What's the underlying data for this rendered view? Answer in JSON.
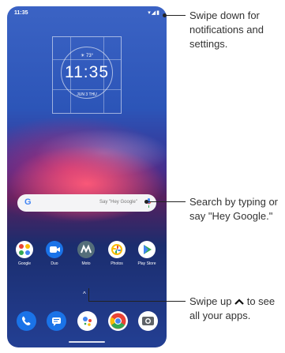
{
  "status_bar": {
    "time": "11:35",
    "icons": "▾◢▮"
  },
  "clock_widget": {
    "weather": "☀ 73°",
    "time": "11:35",
    "date": "JUN 3 THU"
  },
  "search_bar": {
    "logo": "G",
    "hint": "Say \"Hey Google\""
  },
  "apps": [
    {
      "label": "Google"
    },
    {
      "label": "Duo"
    },
    {
      "label": "Moto"
    },
    {
      "label": "Photos"
    },
    {
      "label": "Play Store"
    }
  ],
  "dock": [
    {
      "icon": "phone-icon"
    },
    {
      "icon": "messages-icon"
    },
    {
      "icon": "assistant-icon"
    },
    {
      "icon": "chrome-icon"
    },
    {
      "icon": "camera-icon"
    }
  ],
  "swipe_hint": "^",
  "callouts": {
    "notifications": "Swipe down for notifications and settings.",
    "search": "Search by typing or say \"Hey Google.\"",
    "apps_prefix": "Swipe up",
    "apps_suffix": " to see all your apps."
  }
}
